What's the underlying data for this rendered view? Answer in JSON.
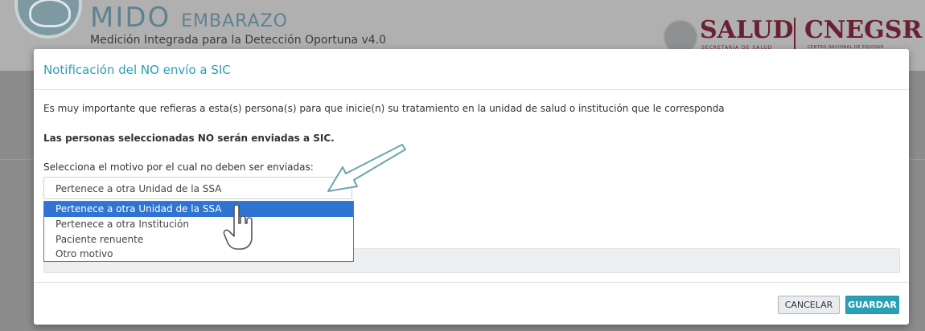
{
  "background": {
    "brand_main": "MIDO",
    "brand_suffix": "EMBARAZO",
    "brand_subtitle": "Medición Integrada para la Detección Oportuna v4.0",
    "salud": "SALUD",
    "salud_sub": "SECRETARÍA DE SALUD",
    "cnegsr": "CNEGSR",
    "cnegsr_sub": "CENTRO NACIONAL DE EQUIDAD"
  },
  "modal": {
    "title": "Notificación del NO envío a SIC",
    "message": "Es muy importante que refieras a esta(s) persona(s) para que inicie(n) su tratamiento en la unidad de salud o institución que le corresponda",
    "warning": "Las personas seleccionadas NO serán enviadas a SIC.",
    "select_label": "Selecciona el motivo por el cual no deben ser enviadas:",
    "select_value": "Pertenece a otra Unidad de la SSA",
    "options": [
      "Pertenece a otra Unidad de la SSA",
      "Pertenece a otra Institución",
      "Paciente renuente",
      "Otro motivo"
    ],
    "selected_index": 0,
    "cancel_label": "CANCELAR",
    "save_label": "GUARDAR"
  },
  "colors": {
    "accent": "#2aa0b6",
    "highlight": "#2f74d0",
    "brand": "#6a2032"
  }
}
